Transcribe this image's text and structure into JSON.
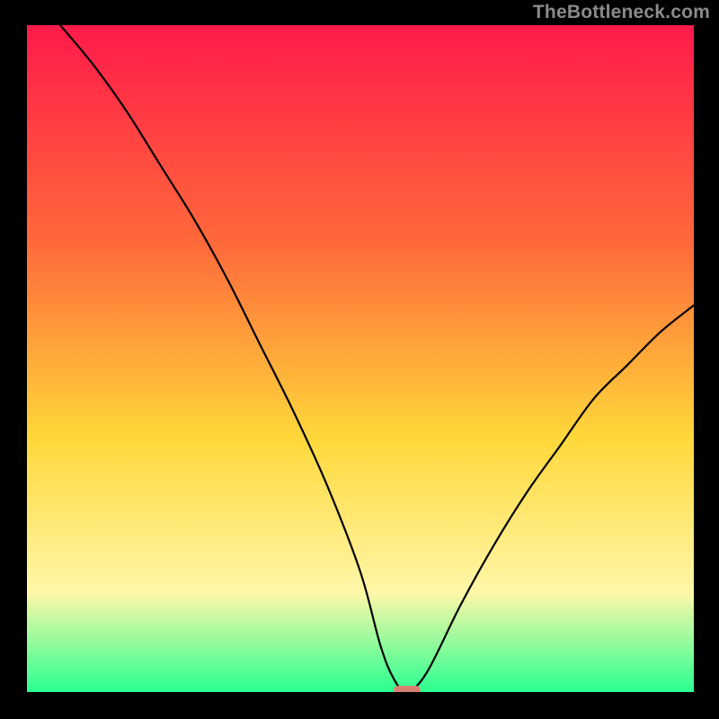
{
  "watermark": "TheBottleneck.com",
  "colors": {
    "gradient_top": "#ff1a4a",
    "gradient_mid_upper": "#ff6a3a",
    "gradient_mid": "#ffd83a",
    "gradient_low": "#fff7a8",
    "gradient_bottom": "#2aff90",
    "frame": "#000000",
    "curve": "#000000",
    "marker": "#d88070"
  },
  "chart_data": {
    "type": "line",
    "title": "",
    "xlabel": "",
    "ylabel": "",
    "xlim": [
      0,
      100
    ],
    "ylim": [
      0,
      100
    ],
    "grid": false,
    "series": [
      {
        "name": "bottleneck-curve",
        "x": [
          5,
          10,
          15,
          20,
          25,
          30,
          35,
          40,
          45,
          50,
          53,
          55,
          57,
          60,
          65,
          70,
          75,
          80,
          85,
          90,
          95,
          100
        ],
        "y": [
          100,
          94,
          87,
          79,
          71,
          62,
          52,
          42,
          31,
          18,
          7,
          2,
          0,
          3,
          13,
          22,
          30,
          37,
          44,
          49,
          54,
          58
        ]
      }
    ],
    "marker": {
      "x": 57,
      "y": 0.3,
      "width": 4,
      "height": 1.3
    }
  }
}
